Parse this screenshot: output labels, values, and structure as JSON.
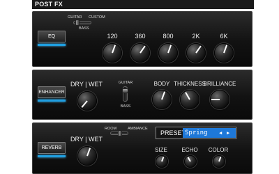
{
  "header": {
    "title": "POST FX"
  },
  "eq": {
    "button": "EQ",
    "led_color": "#1f9fe0",
    "mode_labels": {
      "guitar": "GUITAR",
      "custom": "CUSTOM",
      "bass": "BASS"
    },
    "bands": [
      {
        "label": "120"
      },
      {
        "label": "360"
      },
      {
        "label": "800"
      },
      {
        "label": "2K"
      },
      {
        "label": "6K"
      }
    ]
  },
  "enhancer": {
    "button": "ENHANCER",
    "drywet": "DRY | WET",
    "mode_labels": {
      "guitar": "GUITAR",
      "bass": "BASS"
    },
    "knobs": [
      {
        "label": "BODY"
      },
      {
        "label": "THICKNESS"
      },
      {
        "label": "BRILLIANCE"
      }
    ]
  },
  "reverb": {
    "button": "REVERB",
    "drywet": "DRY | WET",
    "mode_labels": {
      "room": "ROOM",
      "ambiance": "AMBIANCE"
    },
    "preset_label": "PRESET",
    "preset_value": "Spring",
    "preset_prev": "◀",
    "preset_next": "▶",
    "knobs": [
      {
        "label": "SIZE"
      },
      {
        "label": "ECHO"
      },
      {
        "label": "COLOR"
      }
    ]
  }
}
